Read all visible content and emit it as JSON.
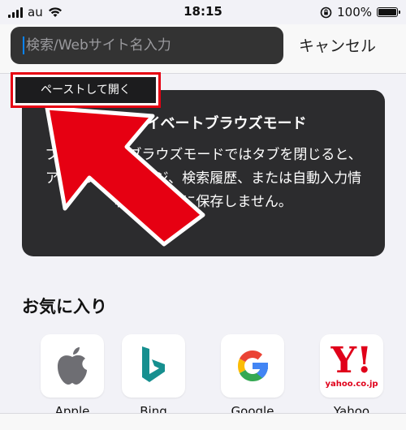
{
  "status_bar": {
    "carrier": "au",
    "time": "18:15",
    "battery": "100%",
    "battery_level": 1.0
  },
  "search": {
    "placeholder": "検索/Webサイト名入力",
    "cancel_label": "キャンセル"
  },
  "paste_menu": {
    "label": "ペーストして開く"
  },
  "private_card": {
    "title": "プライベートブラウズモード",
    "body": "プライベートブラウズモードではタブを閉じると、アクセスしたページ、検索履歴、または自動入力情報をSafariに保存しません。"
  },
  "favorites": {
    "heading": "お気に入り",
    "items": [
      {
        "label": "Apple",
        "icon": "apple-icon"
      },
      {
        "label": "Bing",
        "icon": "bing-icon"
      },
      {
        "label": "Google",
        "icon": "google-icon"
      },
      {
        "label": "Yahoo",
        "icon": "yahoo-icon",
        "logo_text": "Y!",
        "logo_url": "yahoo.co.jp"
      }
    ]
  },
  "colors": {
    "annotation_red": "#e60012",
    "cursor_blue": "#0a84ff",
    "dark_card": "#2c2c2e"
  }
}
